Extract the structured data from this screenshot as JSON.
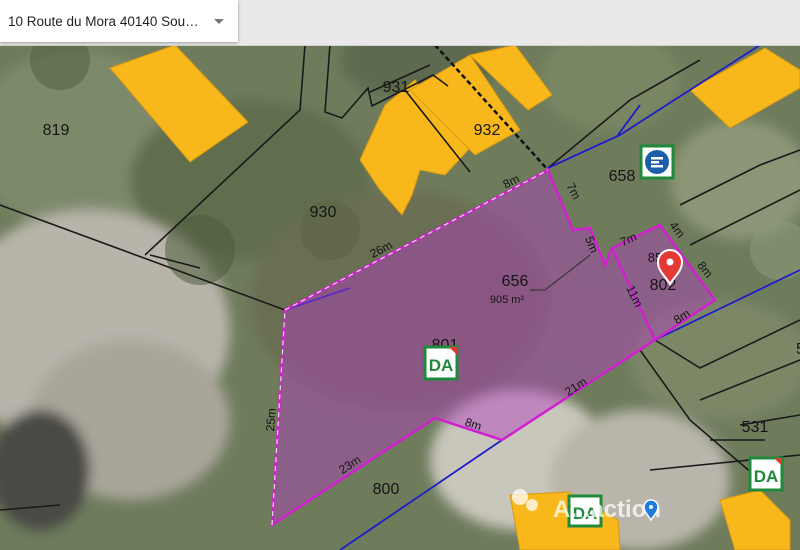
{
  "search": {
    "address": "10 Route du Mora 40140 Soust..."
  },
  "parcels": [
    {
      "id": "p819",
      "label": "819"
    },
    {
      "id": "p931",
      "label": "931"
    },
    {
      "id": "p932",
      "label": "932"
    },
    {
      "id": "p658",
      "label": "658"
    },
    {
      "id": "p930",
      "label": "930"
    },
    {
      "id": "p656",
      "label": "656"
    },
    {
      "id": "p85",
      "label": "85"
    },
    {
      "id": "p802",
      "label": "802"
    },
    {
      "id": "p801",
      "label": "801"
    },
    {
      "id": "p800",
      "label": "800"
    },
    {
      "id": "p531",
      "label": "531"
    },
    {
      "id": "p5",
      "label": "5"
    }
  ],
  "area": {
    "label": "905 m²"
  },
  "dimensions": [
    "8m",
    "7m",
    "26m",
    "5m",
    "7m",
    "4m",
    "8m",
    "11m",
    "8m",
    "25m",
    "21m",
    "8m",
    "23m"
  ],
  "watermark": {
    "text": "A...action"
  },
  "colors": {
    "selection": "#d020d0",
    "cadastre_line": "#1a1a1a",
    "boundary_blue": "#1e1ec8",
    "building": "#f8b81c",
    "pin": "#e53935"
  },
  "icons": [
    "dpu-zone-icon",
    "commerce-zone-icon",
    "location-pin-icon",
    "watermark-pin-icon"
  ]
}
